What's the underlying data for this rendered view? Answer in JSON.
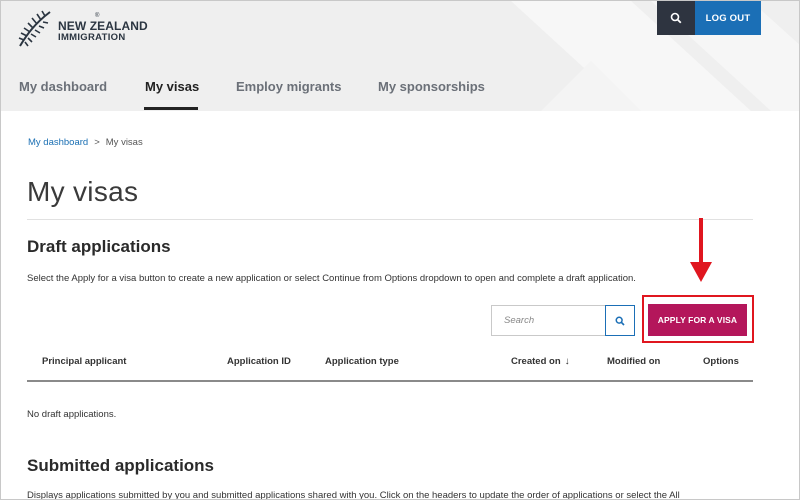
{
  "header": {
    "logo_line1": "NEW ZEALAND",
    "logo_line2": "IMMIGRATION",
    "logo_reg": "®",
    "logout_label": "LOG OUT",
    "icons": {
      "search": "search-icon",
      "logo": "silver-fern-icon"
    }
  },
  "nav": {
    "items": [
      {
        "label": "My dashboard",
        "active": false
      },
      {
        "label": "My visas",
        "active": true
      },
      {
        "label": "Employ migrants",
        "active": false
      },
      {
        "label": "My sponsorships",
        "active": false
      }
    ]
  },
  "breadcrumb": {
    "home": "My dashboard",
    "separator": ">",
    "current": "My visas"
  },
  "page": {
    "title": "My visas"
  },
  "draft": {
    "title": "Draft applications",
    "description": "Select the Apply for a visa button to create a new application or select Continue from Options dropdown to open and complete a draft application.",
    "search_placeholder": "Search",
    "apply_label": "APPLY FOR A VISA",
    "columns": [
      "Principal applicant",
      "Application ID",
      "Application type",
      "Created on",
      "Modified on",
      "Options"
    ],
    "sorted_column": "Created on",
    "sort_direction": "descending",
    "empty_message": "No draft applications."
  },
  "submitted": {
    "title": "Submitted applications",
    "description": "Displays applications submitted by you and submitted applications shared with you. Click on the headers to update the order of applications or select the All"
  },
  "colors": {
    "header_bg": "#efefef",
    "search_button_bg": "#2e3440",
    "logout_bg": "#1b6fb6",
    "apply_bg": "#b4165b",
    "annotation_red": "#e0161f",
    "link": "#1a6fb3"
  }
}
